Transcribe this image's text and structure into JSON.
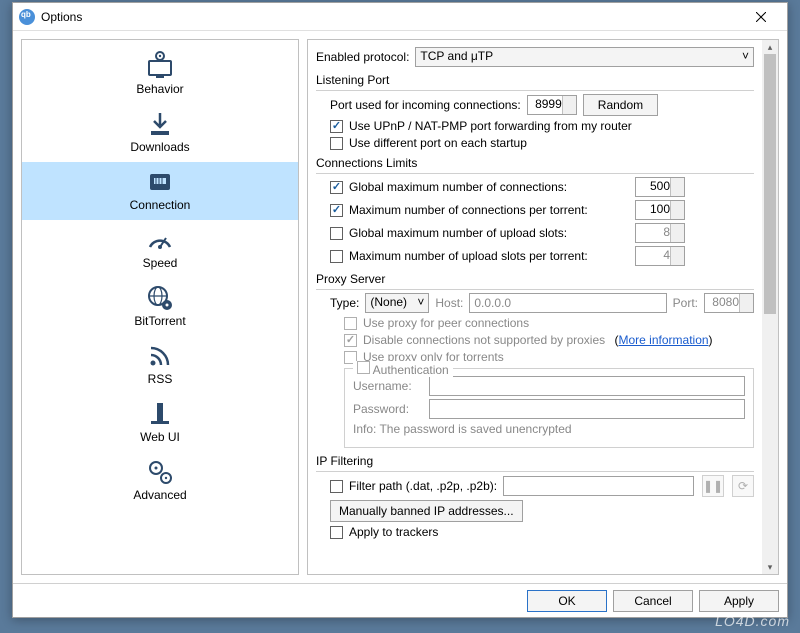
{
  "window": {
    "title": "Options"
  },
  "sidebar": {
    "items": [
      {
        "label": "Behavior"
      },
      {
        "label": "Downloads"
      },
      {
        "label": "Connection"
      },
      {
        "label": "Speed"
      },
      {
        "label": "BitTorrent"
      },
      {
        "label": "RSS"
      },
      {
        "label": "Web UI"
      },
      {
        "label": "Advanced"
      }
    ],
    "selected_index": 2
  },
  "protocol": {
    "label": "Enabled protocol:",
    "value": "TCP and μTP"
  },
  "listening_port": {
    "title": "Listening Port",
    "port_label": "Port used for incoming connections:",
    "port_value": "8999",
    "random_button": "Random",
    "upnp_checked": true,
    "upnp_label": "Use UPnP / NAT-PMP port forwarding from my router",
    "diffport_checked": false,
    "diffport_label": "Use different port on each startup"
  },
  "conn_limits": {
    "title": "Connections Limits",
    "rows": [
      {
        "checked": true,
        "label": "Global maximum number of connections:",
        "value": "500",
        "enabled": true
      },
      {
        "checked": true,
        "label": "Maximum number of connections per torrent:",
        "value": "100",
        "enabled": true
      },
      {
        "checked": false,
        "label": "Global maximum number of upload slots:",
        "value": "8",
        "enabled": false
      },
      {
        "checked": false,
        "label": "Maximum number of upload slots per torrent:",
        "value": "4",
        "enabled": false
      }
    ]
  },
  "proxy": {
    "title": "Proxy Server",
    "type_label": "Type:",
    "type_value": "(None)",
    "host_label": "Host:",
    "host_value": "0.0.0.0",
    "port_label": "Port:",
    "port_value": "8080",
    "use_peer_label": "Use proxy for peer connections",
    "disable_unsupported_label": "Disable connections not supported by proxies",
    "more_info": "More information",
    "only_torrents_label": "Use proxy only for torrents",
    "auth_title": "Authentication",
    "username_label": "Username:",
    "password_label": "Password:",
    "info_text": "Info: The password is saved unencrypted"
  },
  "ip_filter": {
    "title": "IP Filtering",
    "filter_path_label": "Filter path (.dat, .p2p, .p2b):",
    "manual_button": "Manually banned IP addresses...",
    "apply_trackers_label": "Apply to trackers"
  },
  "footer": {
    "ok": "OK",
    "cancel": "Cancel",
    "apply": "Apply"
  },
  "watermark": "LO4D.com"
}
